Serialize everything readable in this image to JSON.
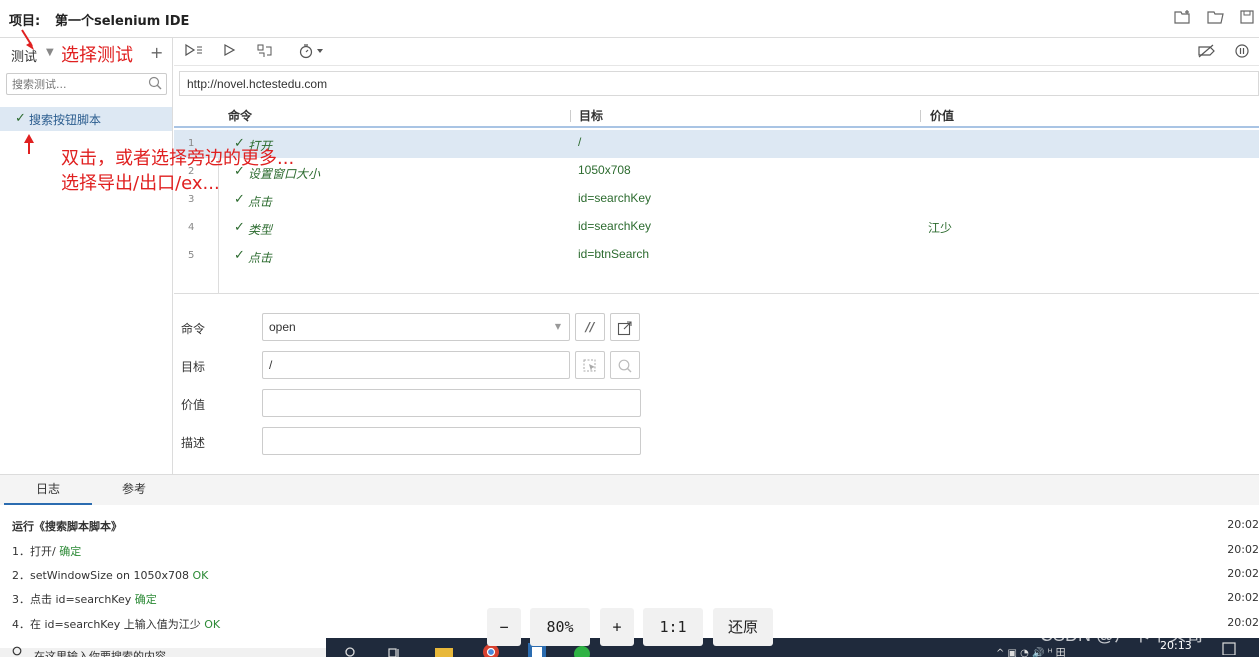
{
  "header": {
    "project_label": "项目:",
    "project_name": "第一个selenium IDE"
  },
  "sidebar": {
    "tests_label": "测试",
    "add_symbol": "+",
    "search_placeholder": "搜索测试...",
    "test_items": [
      {
        "label": "搜索按钮脚本",
        "status": "✓"
      }
    ]
  },
  "url": "http://novel.hctestedu.com",
  "table": {
    "headers": {
      "command": "命令",
      "target": "目标",
      "value": "价值"
    },
    "rows": [
      {
        "num": "1",
        "command": "打开",
        "target": "/",
        "value": ""
      },
      {
        "num": "2",
        "command": "设置窗口大小",
        "target": "1050x708",
        "value": ""
      },
      {
        "num": "3",
        "command": "点击",
        "target": "id=searchKey",
        "value": ""
      },
      {
        "num": "4",
        "command": "类型",
        "target": "id=searchKey",
        "value": "江少"
      },
      {
        "num": "5",
        "command": "点击",
        "target": "id=btnSearch",
        "value": ""
      }
    ]
  },
  "editor": {
    "command_label": "命令",
    "command_value": "open",
    "target_label": "目标",
    "target_value": "/",
    "value_label": "价值",
    "value_value": "",
    "description_label": "描述",
    "description_value": "",
    "comment_button": "//"
  },
  "log": {
    "tabs": {
      "log": "日志",
      "reference": "参考"
    },
    "lines": [
      {
        "text": "运行《搜索脚本脚本》",
        "status": "",
        "time": "20:02",
        "bold": true
      },
      {
        "text": "1．打开/",
        "status": "确定",
        "time": "20:02"
      },
      {
        "text": "2．setWindowSize on 1050x708",
        "status": "OK",
        "time": "20:02"
      },
      {
        "text": "3．点击 id=searchKey",
        "status": "确定",
        "time": "20:02"
      },
      {
        "text": "4．在 id=searchKey 上输入值为江少",
        "status": "OK",
        "time": "20:02"
      }
    ]
  },
  "annotations": {
    "select_test": "选择测试",
    "line1": "双击，或者选择旁边的更多...",
    "line2": "选择导出/出口/ex..."
  },
  "zoom_bar": {
    "minus": "−",
    "level": "80%",
    "plus": "+",
    "one_to_one": "1:1",
    "restore": "还原"
  },
  "taskbar": {
    "search_text": "在这里输入你要搜索的内容",
    "clock": "20:13",
    "watermark": "CSDN @卢卡平头哥"
  },
  "colors": {
    "selected_row": "#dde8f3",
    "ok_green": "#2c6b2f",
    "annotation_red": "#e02020",
    "taskbar": "#1f2a3c"
  }
}
